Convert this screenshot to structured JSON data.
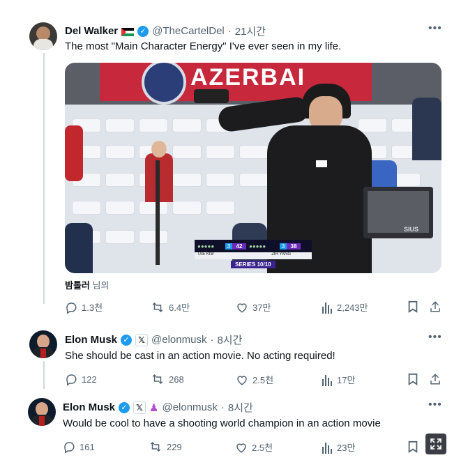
{
  "tweets": [
    {
      "name": "Del Walker",
      "flag_emoji": "🇵🇸",
      "handle": "@TheCartelDel",
      "time": "21시간",
      "text": "The most \"Main Character Energy\" I've ever seen in my life.",
      "media_caption_user": "밤톨러",
      "media_caption_suffix": "님의",
      "replies": "1.3천",
      "retweets": "6.4만",
      "likes": "37만",
      "views": "2,243만"
    },
    {
      "name": "Elon Musk",
      "handle": "@elonmusk",
      "time": "8시간",
      "text": "She should be cast in an action movie. No  acting required!",
      "replies": "122",
      "retweets": "268",
      "likes": "2.5천",
      "views": "17만"
    },
    {
      "name": "Elon Musk",
      "handle": "@elonmusk",
      "time": "8시간",
      "text": "Would be cool to have a shooting world champion in an action movie",
      "replies": "161",
      "retweets": "229",
      "likes": "2.5천",
      "views": "23만"
    }
  ],
  "media": {
    "banner_text": "AZERBAI",
    "score_left_name": "TAE KIM",
    "score_left": "42",
    "score_left_series": "3",
    "score_right_name": "ZIH YANG",
    "score_right": "38",
    "score_right_series": "3",
    "series_text": "SERIES 10/10",
    "monitor_brand": "SIUS"
  },
  "colors": {
    "verified": "#1d9bf0",
    "muted": "#536471",
    "text": "#0f1419"
  },
  "icons": [
    "reply-icon",
    "retweet-icon",
    "like-icon",
    "views-icon",
    "bookmark-icon",
    "share-icon",
    "more-icon",
    "verified-icon",
    "x-logo-icon",
    "affiliate-icon",
    "expand-icon"
  ]
}
